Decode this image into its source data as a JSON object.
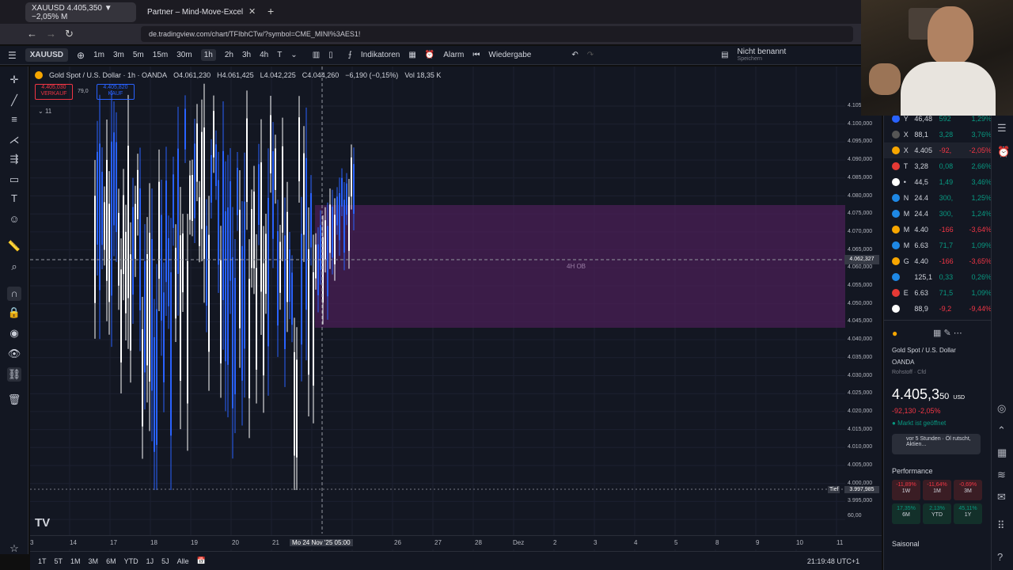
{
  "browser": {
    "tabs": [
      {
        "label": "XAUUSD 4.405,350 ▼ −2,05% M"
      },
      {
        "label": "Partner – Mind-Move-Excel"
      }
    ],
    "url": "de.tradingview.com/chart/TFIbhCTw/?symbol=CME_MINI%3AES1!"
  },
  "toolbar": {
    "symbol": "XAUUSD",
    "intervals": [
      "1m",
      "3m",
      "5m",
      "15m",
      "30m",
      "1h",
      "2h",
      "3h",
      "4h",
      "T"
    ],
    "indicators": "Indikatoren",
    "alarm": "Alarm",
    "replay": "Wiedergabe",
    "layout_name": "Nicht benannt",
    "layout_sub": "Speichern"
  },
  "chart": {
    "title": "Gold Spot / U.S. Dollar · 1h · OANDA",
    "ohlc": {
      "o": "O4.061,230",
      "h": "H4.061,425",
      "l": "L4.042,225",
      "c": "C4.044,260",
      "chg": "−6,190 (−0,15%)",
      "vol": "Vol 18,35 K"
    },
    "sell_price": "4.405,030",
    "sell_label": "VERKAUF",
    "spread": "79,0",
    "buy_price": "4.405,820",
    "buy_label": "KAUF",
    "indicator_count": "11",
    "zone_label": "4H OB",
    "crosshair_price": "4.062,327",
    "low_label": "Tief",
    "low_price": "3.997,985",
    "price_ticks": [
      "4.105",
      "4.100,000",
      "4.095,000",
      "4.090,000",
      "4.085,000",
      "4.080,000",
      "4.075,000",
      "4.070,000",
      "4.065,000",
      "4.060,000",
      "4.055,000",
      "4.050,000",
      "4.045,000",
      "4.040,000",
      "4.035,000",
      "4.030,000",
      "4.025,000",
      "4.020,000",
      "4.015,000",
      "4.010,000",
      "4.005,000",
      "4.000,000",
      "3.995,000"
    ],
    "vol_tick": "60,00",
    "time_ticks": [
      "3",
      "14",
      "17",
      "18",
      "19",
      "20",
      "21",
      "26",
      "27",
      "28",
      "Dez",
      "2",
      "3",
      "4",
      "5",
      "8",
      "9",
      "10",
      "11"
    ],
    "time_cursor": "Mo 24 Nov '25   05:00",
    "colors": {
      "zone": "#4a1f55",
      "candle_up": "#2962ff",
      "candle_down": "#ffffff"
    }
  },
  "bottom": {
    "ranges": [
      "1T",
      "5T",
      "1M",
      "3M",
      "6M",
      "YTD",
      "1J",
      "5J",
      "Alle"
    ],
    "clock": "21:19:48 UTC+1"
  },
  "watchlist": [
    {
      "sym": "Y",
      "last": "46,48",
      "chg": "592",
      "pct": "1,29%",
      "dir": "pos",
      "color": "#2962ff"
    },
    {
      "sym": "X",
      "last": "88,1",
      "chg": "3,28",
      "pct": "3,76%",
      "dir": "pos",
      "color": "#555"
    },
    {
      "sym": "X",
      "last": "4.405",
      "chg": "-92,",
      "pct": "-2,05%",
      "dir": "neg",
      "color": "#f7a600"
    },
    {
      "sym": "T",
      "last": "3,28",
      "chg": "0,08",
      "pct": "2,66%",
      "dir": "pos",
      "color": "#e53935"
    },
    {
      "sym": "•",
      "last": "44,5",
      "chg": "1,49",
      "pct": "3,46%",
      "dir": "pos",
      "color": "#ffffff"
    },
    {
      "sym": "N",
      "last": "24.4",
      "chg": "300,",
      "pct": "1,25%",
      "dir": "pos",
      "color": "#1e88e5"
    },
    {
      "sym": "M",
      "last": "24.4",
      "chg": "300,",
      "pct": "1,24%",
      "dir": "pos",
      "color": "#1e88e5"
    },
    {
      "sym": "M",
      "last": "4.40",
      "chg": "-166",
      "pct": "-3,64%",
      "dir": "neg",
      "color": "#f7a600"
    },
    {
      "sym": "M",
      "last": "6.63",
      "chg": "71,7",
      "pct": "1,09%",
      "dir": "pos",
      "color": "#1e88e5"
    },
    {
      "sym": "G",
      "last": "4.40",
      "chg": "-166",
      "pct": "-3,65%",
      "dir": "neg",
      "color": "#f7a600"
    },
    {
      "sym": "",
      "last": "125,1",
      "chg": "0,33",
      "pct": "0,26%",
      "dir": "pos",
      "color": "#1e88e5"
    },
    {
      "sym": "E",
      "last": "6.63",
      "chg": "71,5",
      "pct": "1,09%",
      "dir": "pos",
      "color": "#e53935"
    },
    {
      "sym": "",
      "last": "88,9",
      "chg": "-9,2",
      "pct": "-9,44%",
      "dir": "neg",
      "color": "#ffffff"
    }
  ],
  "details": {
    "name": "Gold Spot / U.S. Dollar",
    "exchange": "OANDA",
    "type": "Rohstoff · Cfd",
    "price": "4.405,3",
    "price_small": "50",
    "currency": "USD",
    "change": "-92,130 -2,05%",
    "market": "Markt ist geöffnet",
    "news": "vor 5 Stunden · Öl rutscht, Aktien...",
    "performance_title": "Performance",
    "performance": [
      {
        "pct": "-11,89%",
        "label": "1W",
        "dir": "neg"
      },
      {
        "pct": "-11,64%",
        "label": "1M",
        "dir": "neg"
      },
      {
        "pct": "-0,69%",
        "label": "3M",
        "dir": "neg"
      },
      {
        "pct": "17,35%",
        "label": "6M",
        "dir": "pos"
      },
      {
        "pct": "2,13%",
        "label": "YTD",
        "dir": "pos"
      },
      {
        "pct": "45,11%",
        "label": "1Y",
        "dir": "pos"
      }
    ],
    "seasonal": "Saisonal"
  }
}
